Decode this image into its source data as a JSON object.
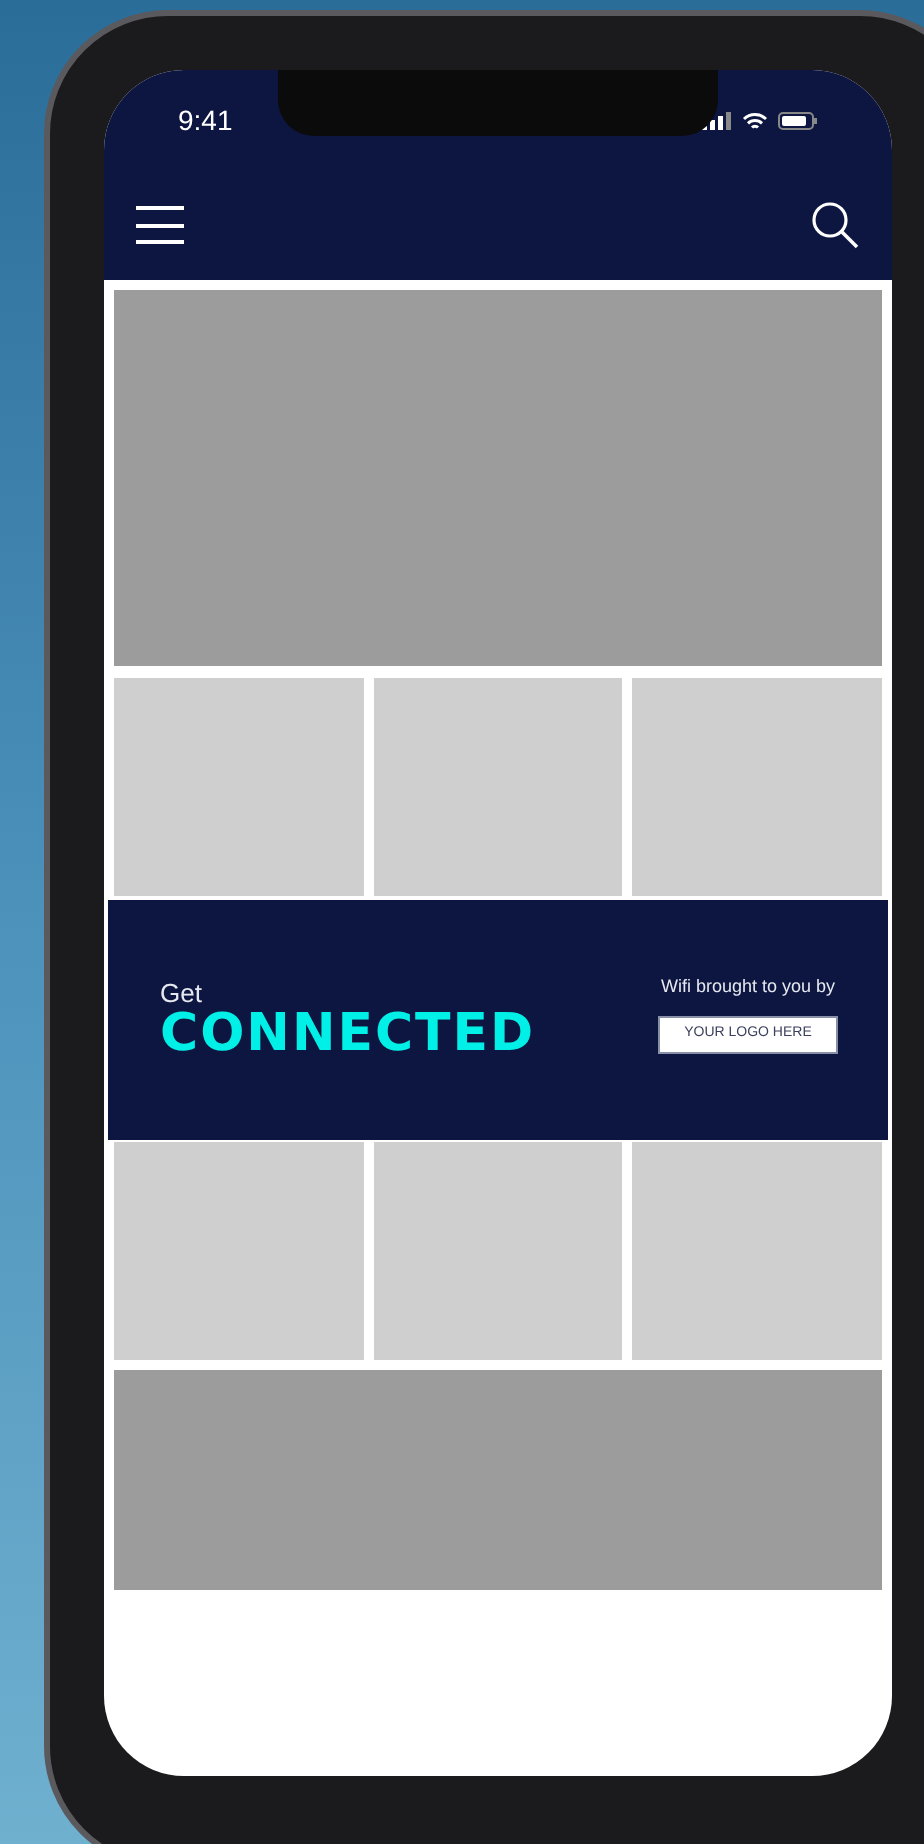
{
  "status_bar": {
    "time": "9:41"
  },
  "sections": [
    {
      "kind": "hero"
    },
    {
      "kind": "tile-row"
    },
    {
      "kind": "banner",
      "heading": "Get",
      "title": "CONNECTED",
      "tagline": "Wifi brought to you by",
      "logo_button": "YOUR LOGO HERE"
    },
    {
      "kind": "tile-row"
    },
    {
      "kind": "hero"
    }
  ]
}
